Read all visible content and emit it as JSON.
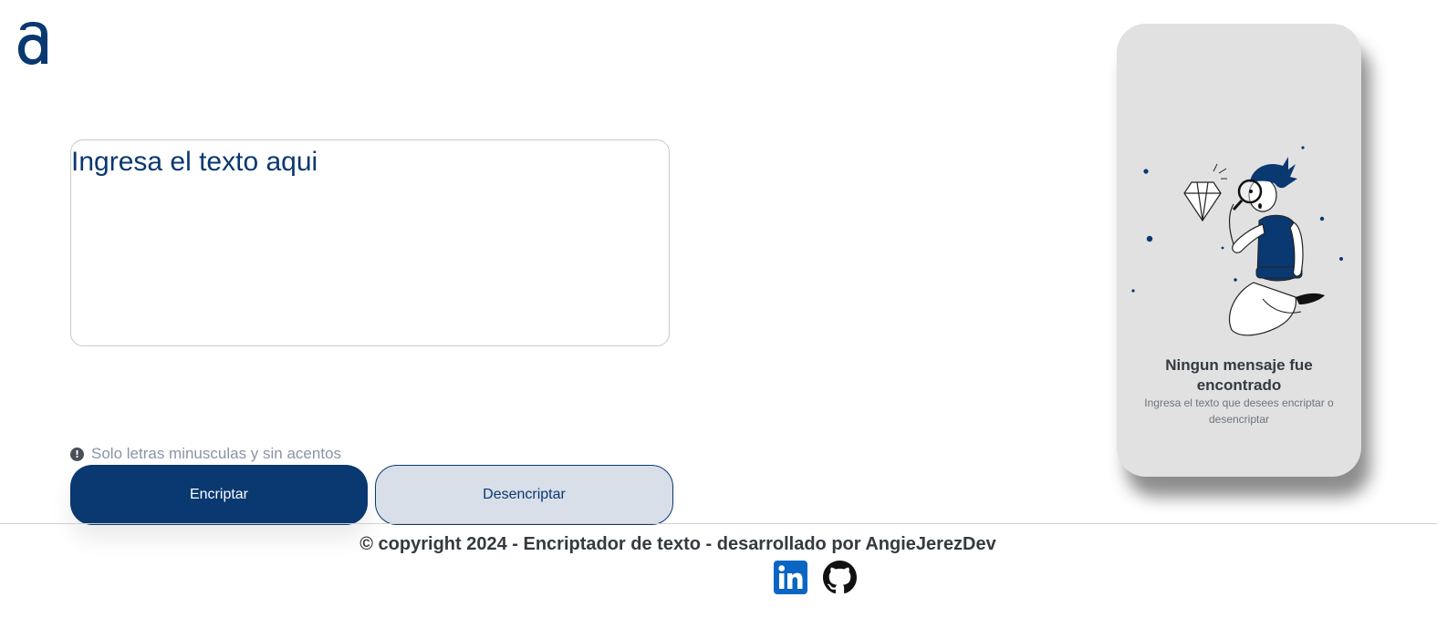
{
  "brand": {
    "logo_letter": "a",
    "logo_color": "#0a3871"
  },
  "input": {
    "placeholder": "Ingresa el texto aqui",
    "value": ""
  },
  "hint": {
    "icon": "exclamation-circle-icon",
    "text": "Solo letras minusculas y sin acentos"
  },
  "buttons": {
    "encrypt_label": "Encriptar",
    "decrypt_label": "Desencriptar"
  },
  "output_panel": {
    "title": "Ningun mensaje fue encontrado",
    "subtitle": "Ingresa el texto que desees encriptar o desencriptar",
    "illustration": "person-with-magnifying-glass-and-diamond"
  },
  "footer": {
    "copyright": "© copyright 2024 - Encriptador de texto - desarrollado por AngieJerezDev",
    "social": [
      {
        "icon": "linkedin-icon",
        "label": "LinkedIn"
      },
      {
        "icon": "github-icon",
        "label": "GitHub"
      }
    ]
  },
  "colors": {
    "primary": "#0a3871",
    "secondary_button_bg": "#d8dfe8",
    "card_bg": "#e1e1e1",
    "text_dark": "#343a40",
    "text_muted": "#8a94a6",
    "linkedin": "#0a66c2"
  }
}
